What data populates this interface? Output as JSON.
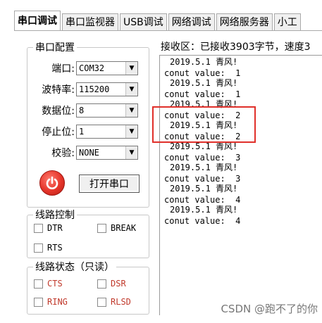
{
  "tabs": [
    {
      "label": "串口调试",
      "active": true
    },
    {
      "label": "串口监视器",
      "active": false
    },
    {
      "label": "USB调试",
      "active": false
    },
    {
      "label": "网络调试",
      "active": false
    },
    {
      "label": "网络服务器",
      "active": false
    },
    {
      "label": "小工",
      "active": false
    }
  ],
  "serial_config": {
    "title": "串口配置",
    "port_label": "端口:",
    "port_value": "COM32",
    "baud_label": "波特率:",
    "baud_value": "115200",
    "data_bits_label": "数据位:",
    "data_bits_value": "8",
    "stop_bits_label": "停止位:",
    "stop_bits_value": "1",
    "parity_label": "校验:",
    "parity_value": "NONE",
    "open_button": "打开串口"
  },
  "line_control": {
    "title": "线路控制",
    "dtr": "DTR",
    "break": "BREAK",
    "rts": "RTS"
  },
  "line_status": {
    "title": "线路状态（只读）",
    "cts": "CTS",
    "dsr": "DSR",
    "ring": "RING",
    "rlsd": "RLSD"
  },
  "receive": {
    "title": "接收区：已接收3903字节，速度3",
    "lines": [
      "2019.5.1 青风!",
      "conut value:  1",
      "2019.5.1 青风!",
      "conut value:  1",
      "2019.5.1 青风!",
      "conut value:  2",
      "2019.5.1 青风!",
      "conut value:  2",
      "2019.5.1 青风!",
      "conut value:  3",
      "2019.5.1 青风!",
      "conut value:  3",
      "2019.5.1 青风!",
      "conut value:  4",
      "2019.5.1 青风!",
      "conut value:  4"
    ]
  },
  "watermark": "CSDN @跑不了的你",
  "colors": {
    "highlight": "#e0302a",
    "status_text": "#c0392b"
  }
}
